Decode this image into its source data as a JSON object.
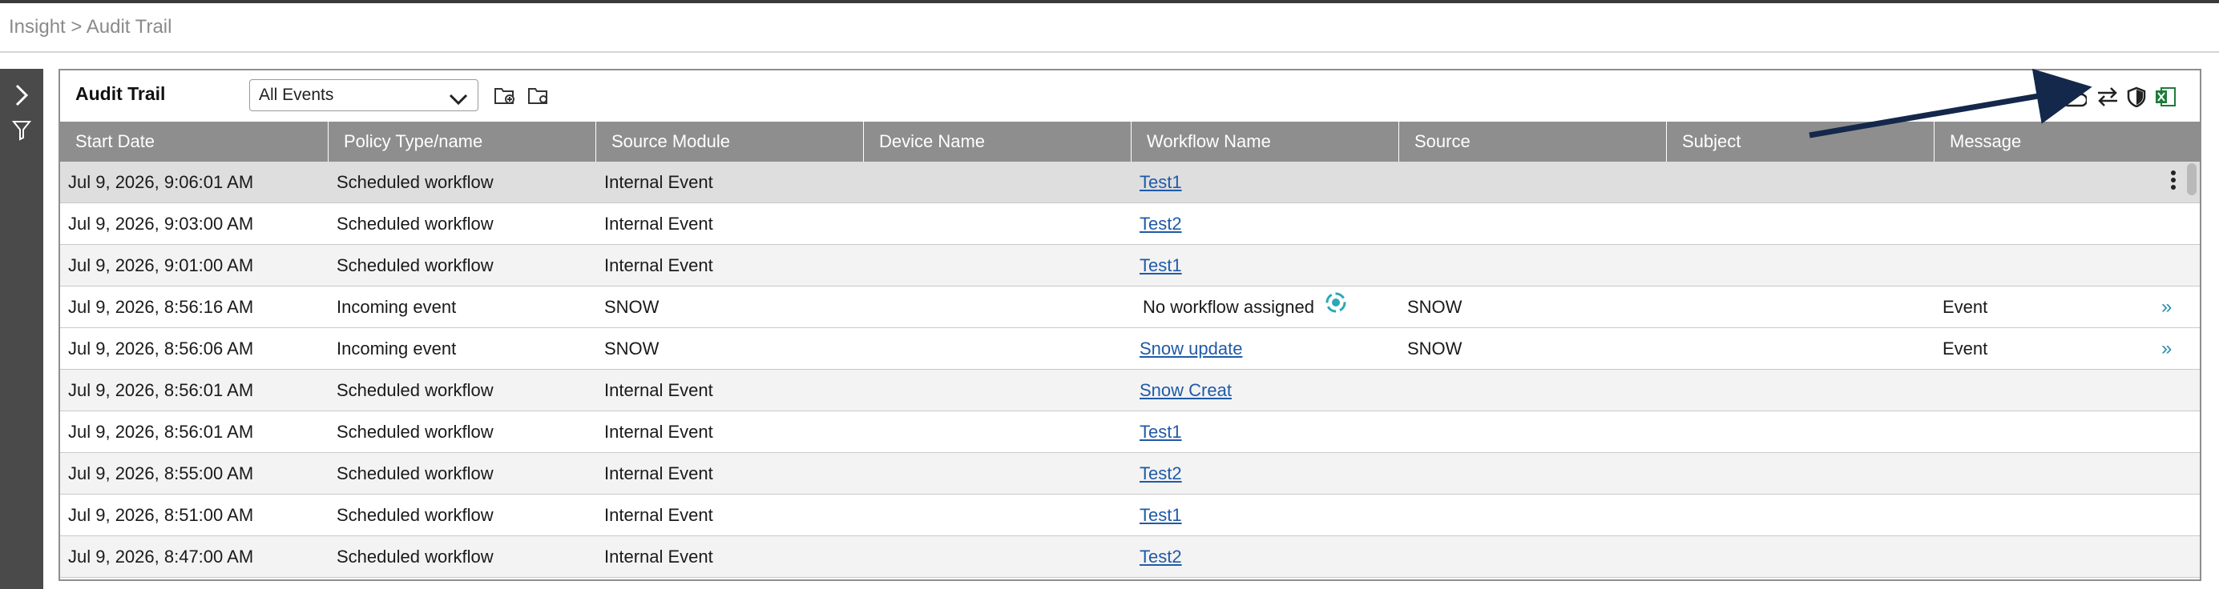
{
  "breadcrumb": "Insight > Audit Trail",
  "panel": {
    "title": "Audit Trail",
    "filter_value": "All Events"
  },
  "columns": [
    "Start Date",
    "Policy Type/name",
    "Source Module",
    "Device Name",
    "Workflow Name",
    "Source",
    "Subject",
    "Message"
  ],
  "rows": [
    {
      "start": "Jul 9, 2026, 9:06:01 AM",
      "policy": "Scheduled workflow",
      "module": "Internal Event",
      "device": "",
      "workflow": "Test1",
      "source": "",
      "subject": "",
      "message": ""
    },
    {
      "start": "Jul 9, 2026, 9:03:00 AM",
      "policy": "Scheduled workflow",
      "module": "Internal Event",
      "device": "",
      "workflow": "Test2",
      "source": "",
      "subject": "",
      "message": ""
    },
    {
      "start": "Jul 9, 2026, 9:01:00 AM",
      "policy": "Scheduled workflow",
      "module": "Internal Event",
      "device": "",
      "workflow": "Test1",
      "source": "",
      "subject": "",
      "message": ""
    },
    {
      "start": "Jul 9, 2026, 8:56:16 AM",
      "policy": "Incoming event",
      "module": "SNOW",
      "device": "",
      "workflow": "No workflow assigned",
      "source": "SNOW",
      "subject": "",
      "message": "Event"
    },
    {
      "start": "Jul 9, 2026, 8:56:06 AM",
      "policy": "Incoming event",
      "module": "SNOW",
      "device": "",
      "workflow": "Snow update",
      "source": "SNOW",
      "subject": "",
      "message": "Event"
    },
    {
      "start": "Jul 9, 2026, 8:56:01 AM",
      "policy": "Scheduled workflow",
      "module": "Internal Event",
      "device": "",
      "workflow": "Snow Creat",
      "source": "",
      "subject": "",
      "message": ""
    },
    {
      "start": "Jul 9, 2026, 8:56:01 AM",
      "policy": "Scheduled workflow",
      "module": "Internal Event",
      "device": "",
      "workflow": "Test1",
      "source": "",
      "subject": "",
      "message": ""
    },
    {
      "start": "Jul 9, 2026, 8:55:00 AM",
      "policy": "Scheduled workflow",
      "module": "Internal Event",
      "device": "",
      "workflow": "Test2",
      "source": "",
      "subject": "",
      "message": ""
    },
    {
      "start": "Jul 9, 2026, 8:51:00 AM",
      "policy": "Scheduled workflow",
      "module": "Internal Event",
      "device": "",
      "workflow": "Test1",
      "source": "",
      "subject": "",
      "message": ""
    },
    {
      "start": "Jul 9, 2026, 8:47:00 AM",
      "policy": "Scheduled workflow",
      "module": "Internal Event",
      "device": "",
      "workflow": "Test2",
      "source": "",
      "subject": "",
      "message": ""
    }
  ],
  "icons": {
    "sidebar": [
      "chevron-right-icon",
      "filter-icon"
    ],
    "toolbar_left": [
      "folder-add-icon",
      "folder-settings-icon"
    ],
    "toolbar_right": [
      "cloud-icon",
      "swap-arrows-icon",
      "shield-icon",
      "excel-export-icon"
    ],
    "row": [
      "kebab-menu-icon",
      "double-chevron-right-icon",
      "spinner-icon"
    ]
  },
  "colors": {
    "header_bg": "#8e8e8e",
    "link": "#1f5aa8",
    "selected_row": "#dedede",
    "sidebar_bg": "#4a4a4a",
    "accent_teal": "#2aa8b8",
    "annotation_arrow": "#14284b",
    "excel_green": "#1e7a3c"
  }
}
